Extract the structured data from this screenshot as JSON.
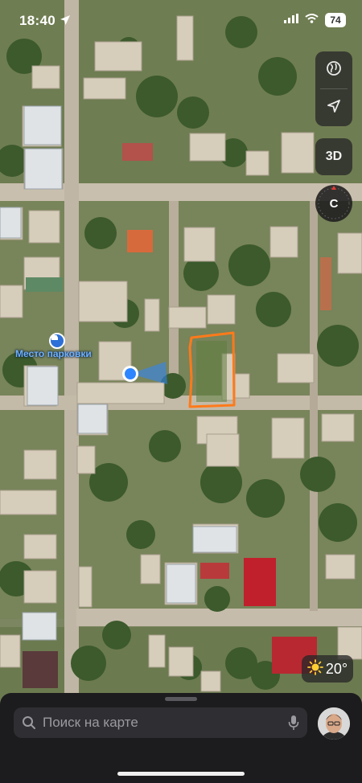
{
  "status_bar": {
    "time": "18:40",
    "battery": "74"
  },
  "map": {
    "type": "satellite",
    "poi_label": "Место парковки",
    "icons": [
      "location-arrow-icon",
      "signal-bars-icon",
      "wifi-icon",
      "globe-icon",
      "navigation-arrow-icon",
      "car-icon",
      "user-location-icon",
      "sun-icon",
      "search-icon",
      "microphone-icon"
    ]
  },
  "controls": {
    "view_3d_label": "3D",
    "compass_label": "С"
  },
  "weather": {
    "temperature": "20°"
  },
  "search": {
    "placeholder": "Поиск на карте"
  },
  "colors": {
    "highlight_outline": "#ff7a1a",
    "user_location": "#2e86ff",
    "sheet_bg": "#1c1c1e"
  }
}
